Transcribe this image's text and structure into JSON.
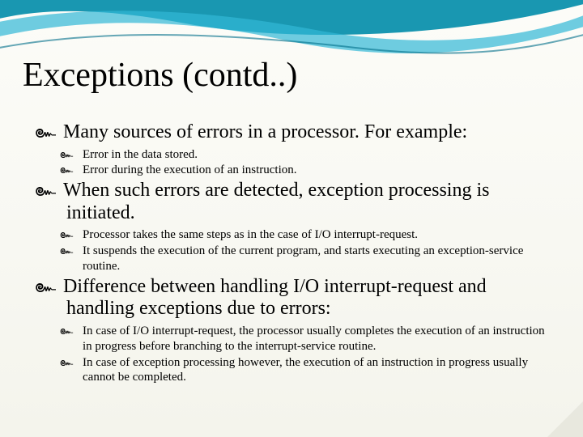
{
  "title": "Exceptions (contd..)",
  "bullets": [
    {
      "level": 1,
      "text": "Many sources of errors in a processor. For example:"
    },
    {
      "level": 2,
      "text": "Error in the data stored."
    },
    {
      "level": 2,
      "text": "Error during the execution of an instruction."
    },
    {
      "level": 1,
      "text": "When such errors are detected, exception processing is initiated."
    },
    {
      "level": 2,
      "text": "Processor takes the same steps as in the case of I/O interrupt-request."
    },
    {
      "level": 2,
      "text": "It suspends the execution of the current program, and starts executing an exception-service routine."
    },
    {
      "level": 1,
      "text": "Difference between handling I/O interrupt-request and handling exceptions due to errors:"
    },
    {
      "level": 2,
      "text": "In case of I/O interrupt-request, the processor usually completes the execution of an instruction in progress before branching to the interrupt-service routine."
    },
    {
      "level": 2,
      "text": "In case of exception processing however, the execution of an instruction in progress usually cannot be completed."
    }
  ],
  "glyph": "๛"
}
